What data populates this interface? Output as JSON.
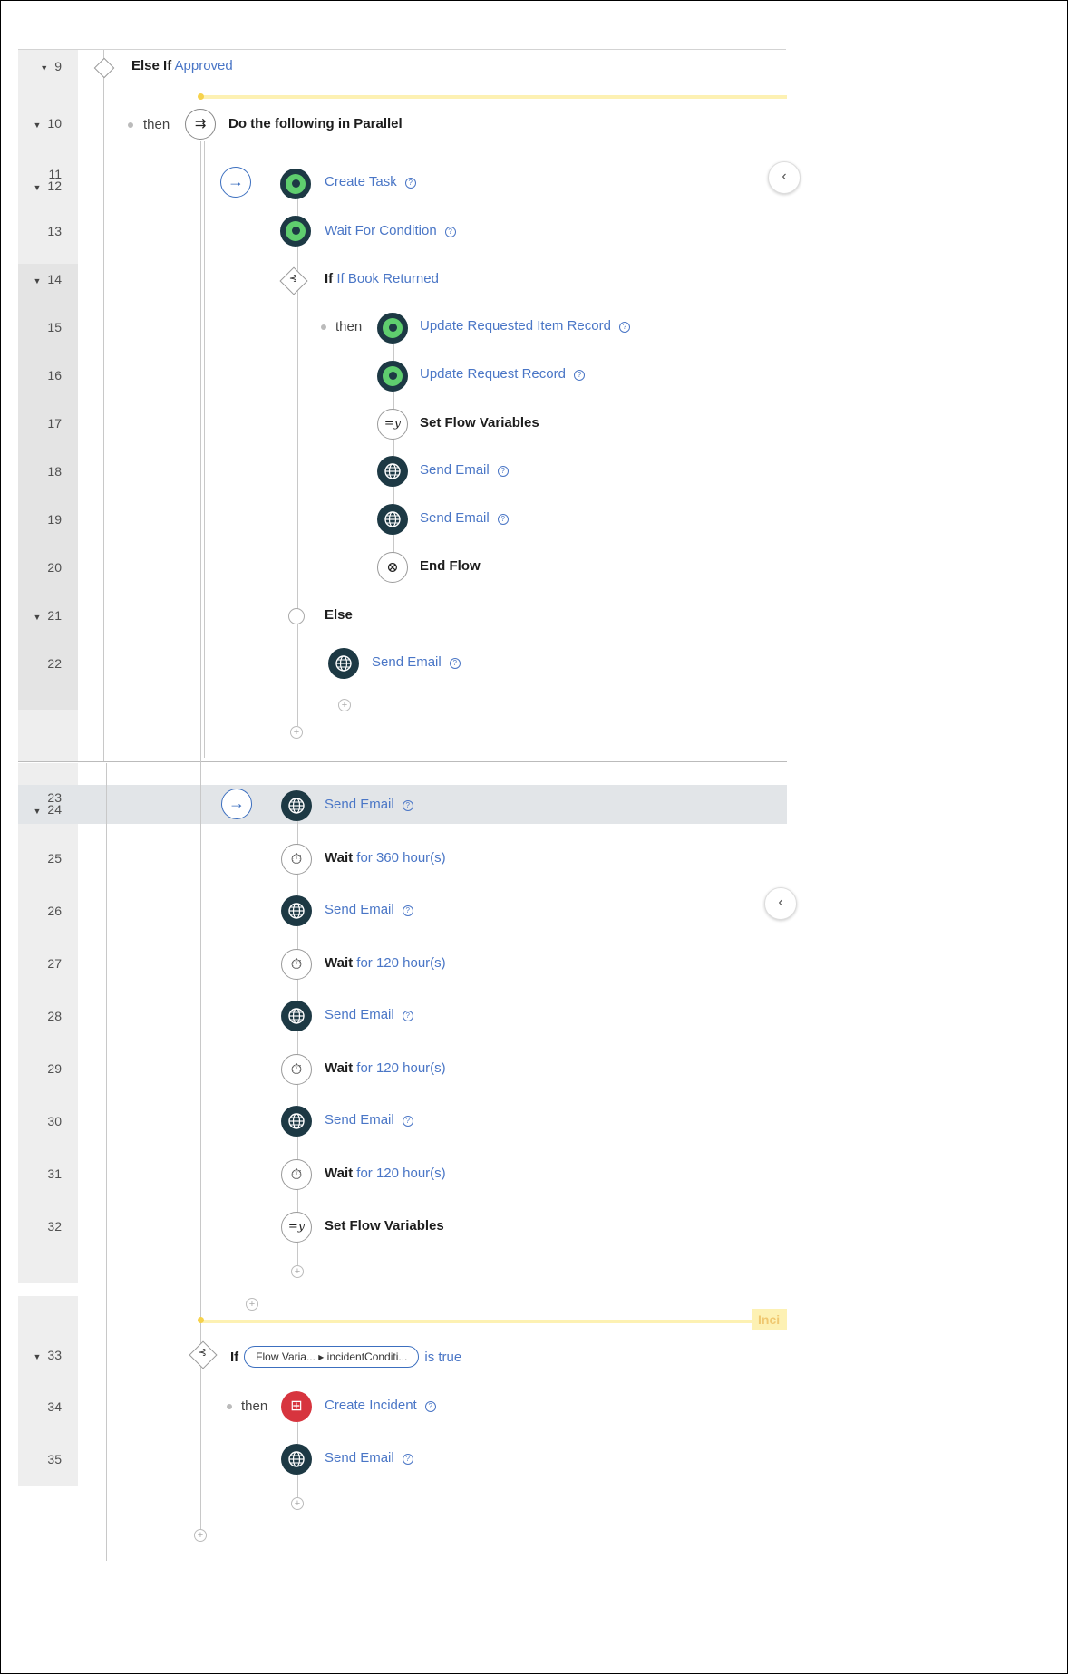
{
  "upper": {
    "else_if": {
      "number": "9",
      "keyword": "Else If",
      "condition": "Approved"
    },
    "parallel": {
      "number": "10",
      "then": "then",
      "label": "Do the following in Parallel"
    },
    "rows": [
      {
        "number_a": "11",
        "number_b": "12",
        "label": "Create Task",
        "icon": "action-icon"
      },
      {
        "number": "13",
        "label": "Wait For Condition",
        "icon": "action-icon"
      },
      {
        "number": "14",
        "keyword": "If",
        "condition": "If Book Returned"
      },
      {
        "number": "15",
        "then": "then",
        "label": "Update Requested Item Record",
        "icon": "action-icon"
      },
      {
        "number": "16",
        "label": "Update Request Record",
        "icon": "action-icon"
      },
      {
        "number": "17",
        "label": "Set Flow Variables",
        "icon": "variable-icon"
      },
      {
        "number": "18",
        "label": "Send Email",
        "icon": "globe-icon"
      },
      {
        "number": "19",
        "label": "Send Email",
        "icon": "globe-icon"
      },
      {
        "number": "20",
        "label": "End Flow",
        "icon": "end-icon"
      },
      {
        "number": "21",
        "keyword": "Else"
      },
      {
        "number": "22",
        "label": "Send Email",
        "icon": "globe-icon"
      }
    ]
  },
  "lower": {
    "rows": [
      {
        "number_a": "23",
        "number_b": "24",
        "label": "Send Email"
      },
      {
        "number": "25",
        "keyword": "Wait",
        "detail": "for 360 hour(s)"
      },
      {
        "number": "26",
        "label": "Send Email"
      },
      {
        "number": "27",
        "keyword": "Wait",
        "detail": "for 120 hour(s)"
      },
      {
        "number": "28",
        "label": "Send Email"
      },
      {
        "number": "29",
        "keyword": "Wait",
        "detail": "for 120 hour(s)"
      },
      {
        "number": "30",
        "label": "Send Email"
      },
      {
        "number": "31",
        "keyword": "Wait",
        "detail": "for 120 hour(s)"
      },
      {
        "number": "32",
        "label": "Set Flow Variables"
      }
    ],
    "if_row": {
      "number": "33",
      "keyword": "If",
      "pill_left": "Flow Varia...",
      "pill_right": "incidentConditi...",
      "suffix": "is true"
    },
    "incident": {
      "number": "34",
      "then": "then",
      "label": "Create Incident"
    },
    "email": {
      "number": "35",
      "label": "Send Email"
    },
    "tag": "Inci"
  },
  "help_glyph": "?",
  "collapse_glyph": "‹",
  "colors": {
    "link": "#4a76c6",
    "green": "#5fce6e",
    "dark": "#1d3944",
    "red": "#d7343e",
    "yellow": "#fdf1b3"
  }
}
